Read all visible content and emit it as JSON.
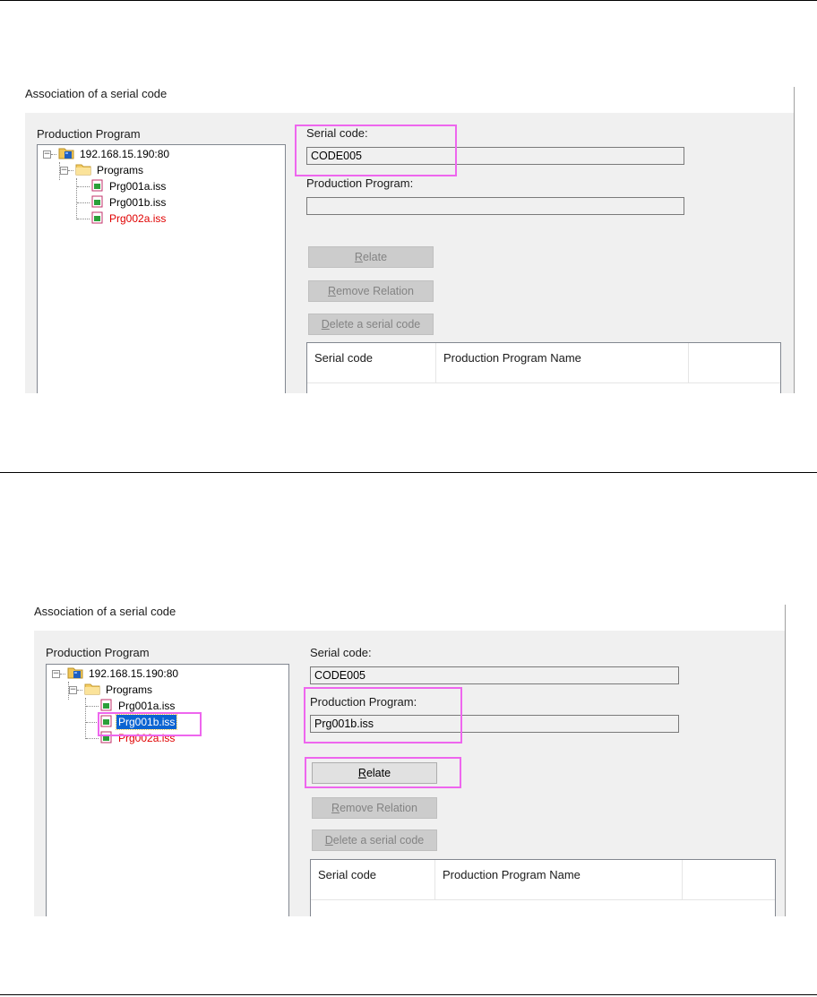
{
  "top": {
    "title": "Association of a serial code",
    "tree_label": "Production Program",
    "tree": {
      "root": "192.168.15.190:80",
      "folder": "Programs",
      "files": [
        "Prg001a.iss",
        "Prg001b.iss",
        "Prg002a.iss"
      ]
    },
    "serial_code_label": "Serial code:",
    "serial_code_value": "CODE005",
    "production_program_label": "Production Program:",
    "production_program_value": "",
    "buttons": {
      "relate_mn": "R",
      "relate_rest": "elate",
      "remove_mn": "R",
      "remove_rest": "emove Relation",
      "delete_mn": "D",
      "delete_rest": "elete a serial code"
    },
    "columns": [
      "Serial code",
      "Production Program Name"
    ]
  },
  "bottom": {
    "title": "Association of a serial code",
    "tree_label": "Production Program",
    "tree": {
      "root": "192.168.15.190:80",
      "folder": "Programs",
      "files": [
        "Prg001a.iss",
        "Prg001b.iss",
        "Prg002a.iss"
      ]
    },
    "serial_code_label": "Serial code:",
    "serial_code_value": "CODE005",
    "production_program_label": "Production Program:",
    "production_program_value": "Prg001b.iss",
    "buttons": {
      "relate_mn": "R",
      "relate_rest": "elate",
      "remove_mn": "R",
      "remove_rest": "emove Relation",
      "delete_mn": "D",
      "delete_rest": "elete a serial code"
    },
    "columns": [
      "Serial code",
      "Production Program Name"
    ]
  },
  "colors": {
    "highlight": "#ee66ee",
    "selection": "#0a64d2",
    "disabled_text": "#838383",
    "red_file": "#e00000"
  },
  "icons": [
    "server-icon",
    "folder-icon",
    "script-file-icon"
  ]
}
